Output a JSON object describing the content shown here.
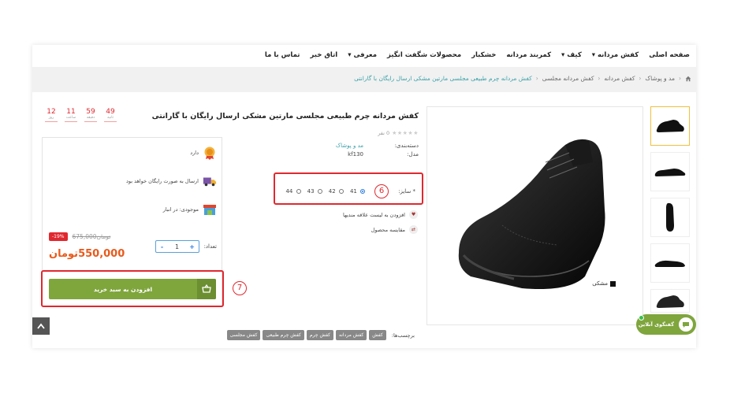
{
  "nav": {
    "items": [
      "صفحه اصلی",
      "کفش مردانه ▾",
      "کیف ▾",
      "کمربند مردانه",
      "خشکبار",
      "محصولات شگفت انگیز",
      "معرفی ▾",
      "اتاق خبر",
      "تماس با ما"
    ]
  },
  "breadcrumb": {
    "items": [
      "مد و پوشاک",
      "کفش مردانه",
      "کفش مردانه مجلسی"
    ],
    "current": "کفش مردانه چرم طبیعی مجلسی مارتین مشکی ارسال رایگان با گارانتی"
  },
  "product": {
    "title": "کفش مردانه چرم طبیعی مجلسی مارتین مشکی ارسال رایگان با گارانتی",
    "stars": "★★★★★",
    "rating_text": "0 نفر",
    "category_label": "دسته‌بندی:",
    "category_value": "مد و پوشاک",
    "model_label": "مدل:",
    "model_value": "kf130",
    "size_label": "* سایز:",
    "sizes": [
      "41",
      "42",
      "43",
      "44"
    ],
    "selected_size": "41",
    "wishlist": "افزودن به لیست علاقه مندیها",
    "compare": "مقایسه محصول",
    "color_label": "مشکی",
    "annotation_6": "6",
    "annotation_7": "7"
  },
  "countdown": {
    "seconds": "49",
    "seconds_label": "ثانیه",
    "minutes": "59",
    "minutes_label": "دقیقه",
    "hours": "11",
    "hours_label": "ساعت",
    "days": "12",
    "days_label": "روز"
  },
  "buybox": {
    "warranty": "دارد",
    "shipping": "ارسال به صورت رایگان خواهد بود",
    "stock": "موجودی: در انبار",
    "discount": "-19%",
    "old_price": "675,000تومان",
    "new_price": "550,000تومان",
    "qty_label": "تعداد:",
    "qty_minus": "-",
    "qty_plus": "+",
    "qty_value": "1",
    "add_to_cart": "افزودن به سبد خرید"
  },
  "tags": {
    "label": "برچسب‌ها:",
    "items": [
      "کفش",
      "کفش مردانه",
      "کفش چرم",
      "کفش چرم طبیعی",
      "کفش مجلسی"
    ]
  },
  "chat": {
    "label": "گفتگوی آنلاین"
  },
  "colors": {
    "accent_red": "#e0282f",
    "green": "#7fa53d",
    "teal": "#3aa0a8",
    "price_orange": "#e85a1c"
  }
}
